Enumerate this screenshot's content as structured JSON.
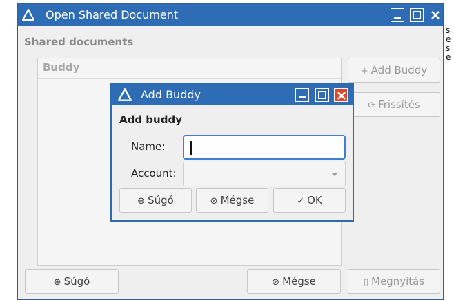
{
  "main_window": {
    "title": "Open Shared Document",
    "section_title": "Shared documents",
    "list_header": "Buddy",
    "add_buddy_label": "Add Buddy",
    "refresh_label": "Frissítés",
    "help_label": "Súgó",
    "cancel_label": "Mégse",
    "open_label": "Megnyitás"
  },
  "dialog": {
    "title": "Add Buddy",
    "heading": "Add buddy",
    "name_label": "Name:",
    "name_value": "",
    "account_label": "Account:",
    "account_value": "",
    "help_label": "Súgó",
    "cancel_label": "Mégse",
    "ok_label": "OK"
  },
  "edge_text": [
    "s",
    "e",
    "s",
    "e"
  ],
  "colors": {
    "titlebar": "#2e6cb6",
    "close_button": "#e0482c",
    "focus_border": "#3d7fd1",
    "window_bg": "#efefef"
  },
  "icons": {
    "app": "abiword-triangle-icon",
    "add": "plus-icon",
    "refresh": "refresh-icon",
    "help": "lifebuoy-icon",
    "cancel": "cancel-circle-icon",
    "ok": "checkmark-icon",
    "open": "document-icon"
  }
}
